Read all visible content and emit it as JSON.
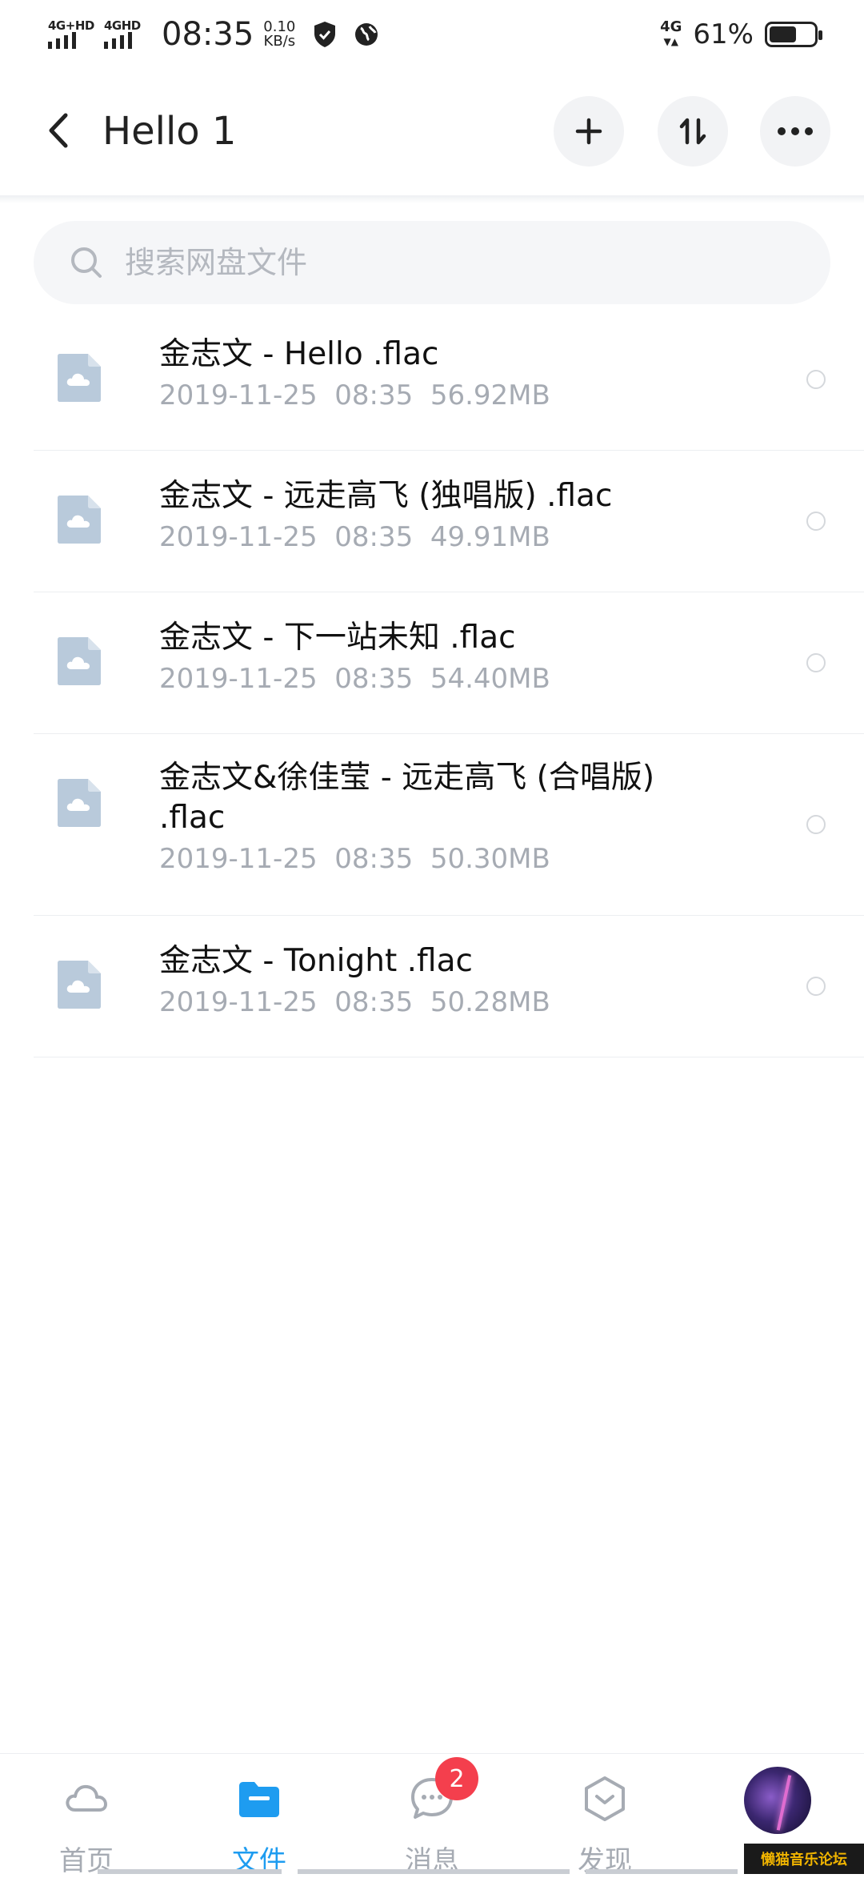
{
  "status_bar": {
    "sim1_label": "4G+HD",
    "sim2_label": "4GHD",
    "time": "08:35",
    "speed_value": "0.10",
    "speed_unit": "KB/s",
    "network": "4G",
    "battery_percent": "61%",
    "battery_level": 0.61,
    "icons": [
      "shield-icon",
      "globe-icon"
    ]
  },
  "header": {
    "title": "Hello 1",
    "buttons": [
      "add-icon",
      "sort-icon",
      "more-icon"
    ]
  },
  "search": {
    "placeholder": "搜索网盘文件"
  },
  "files": [
    {
      "name": "金志文 - Hello .flac",
      "date": "2019-11-25",
      "time": "08:35",
      "size": "56.92MB"
    },
    {
      "name": "金志文 - 远走高飞 (独唱版) .flac",
      "date": "2019-11-25",
      "time": "08:35",
      "size": "49.91MB"
    },
    {
      "name": "金志文 - 下一站未知 .flac",
      "date": "2019-11-25",
      "time": "08:35",
      "size": "54.40MB"
    },
    {
      "name": "金志文&徐佳莹 - 远走高飞 (合唱版) .flac",
      "date": "2019-11-25",
      "time": "08:35",
      "size": "50.30MB"
    },
    {
      "name": "金志文 - Tonight .flac",
      "date": "2019-11-25",
      "time": "08:35",
      "size": "50.28MB"
    }
  ],
  "bottom_nav": {
    "tabs": [
      {
        "label": "首页",
        "icon": "cloud-icon"
      },
      {
        "label": "文件",
        "icon": "folder-icon"
      },
      {
        "label": "消息",
        "icon": "chat-icon"
      },
      {
        "label": "发现",
        "icon": "discover-icon"
      }
    ],
    "active_index": 1,
    "message_badge": "2"
  },
  "watermark": "懒猫音乐论坛",
  "colors": {
    "accent": "#1e9cf0",
    "badge": "#f43f4d",
    "file_icon": "#b9cadb",
    "meta_text": "#a6abb3"
  }
}
